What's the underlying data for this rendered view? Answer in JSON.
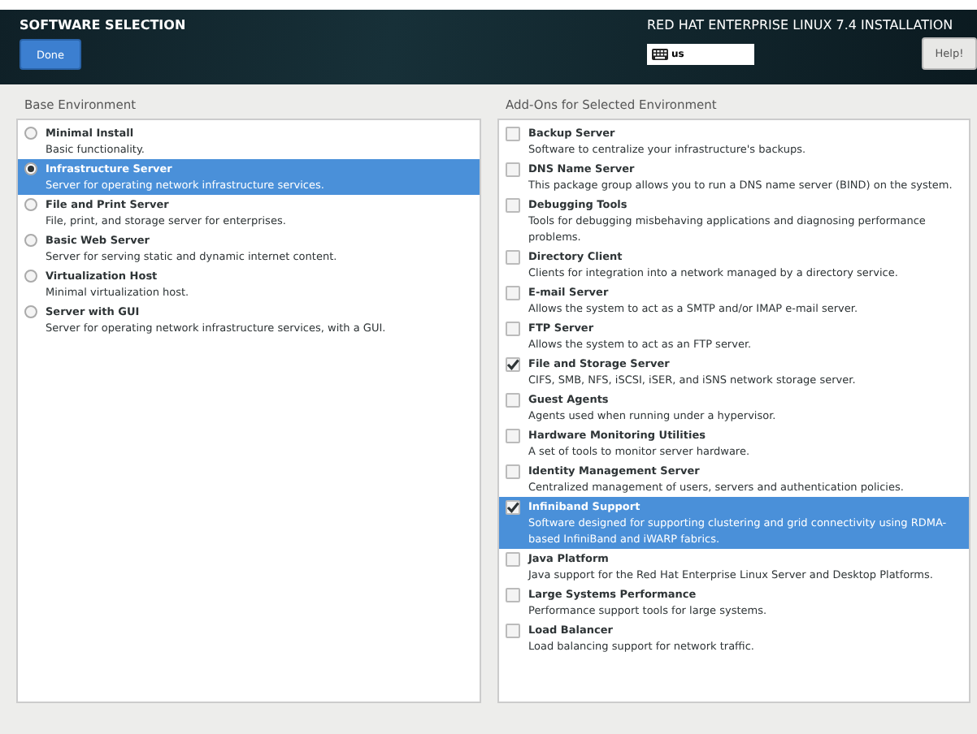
{
  "header": {
    "title": "SOFTWARE SELECTION",
    "done_button": "Done",
    "product": "RED HAT ENTERPRISE LINUX 7.4 INSTALLATION",
    "keyboard_layout": "us",
    "help_button": "Help!"
  },
  "base_environment": {
    "heading": "Base Environment",
    "items": [
      {
        "name": "Minimal Install",
        "description": "Basic functionality.",
        "selected": false
      },
      {
        "name": "Infrastructure Server",
        "description": "Server for operating network infrastructure services.",
        "selected": true
      },
      {
        "name": "File and Print Server",
        "description": "File, print, and storage server for enterprises.",
        "selected": false
      },
      {
        "name": "Basic Web Server",
        "description": "Server for serving static and dynamic internet content.",
        "selected": false
      },
      {
        "name": "Virtualization Host",
        "description": "Minimal virtualization host.",
        "selected": false
      },
      {
        "name": "Server with GUI",
        "description": "Server for operating network infrastructure services, with a GUI.",
        "selected": false
      }
    ]
  },
  "addons": {
    "heading": "Add-Ons for Selected Environment",
    "items": [
      {
        "name": "Backup Server",
        "description": "Software to centralize your infrastructure's backups.",
        "checked": false,
        "selected": false
      },
      {
        "name": "DNS Name Server",
        "description": "This package group allows you to run a DNS name server (BIND) on the system.",
        "checked": false,
        "selected": false
      },
      {
        "name": "Debugging Tools",
        "description": "Tools for debugging misbehaving applications and diagnosing performance problems.",
        "checked": false,
        "selected": false
      },
      {
        "name": "Directory Client",
        "description": "Clients for integration into a network managed by a directory service.",
        "checked": false,
        "selected": false
      },
      {
        "name": "E-mail Server",
        "description": "Allows the system to act as a SMTP and/or IMAP e-mail server.",
        "checked": false,
        "selected": false
      },
      {
        "name": "FTP Server",
        "description": "Allows the system to act as an FTP server.",
        "checked": false,
        "selected": false
      },
      {
        "name": "File and Storage Server",
        "description": "CIFS, SMB, NFS, iSCSI, iSER, and iSNS network storage server.",
        "checked": true,
        "selected": false
      },
      {
        "name": "Guest Agents",
        "description": "Agents used when running under a hypervisor.",
        "checked": false,
        "selected": false
      },
      {
        "name": "Hardware Monitoring Utilities",
        "description": "A set of tools to monitor server hardware.",
        "checked": false,
        "selected": false
      },
      {
        "name": "Identity Management Server",
        "description": "Centralized management of users, servers and authentication policies.",
        "checked": false,
        "selected": false
      },
      {
        "name": "Infiniband Support",
        "description": "Software designed for supporting clustering and grid connectivity using RDMA-based InfiniBand and iWARP fabrics.",
        "checked": true,
        "selected": true
      },
      {
        "name": "Java Platform",
        "description": "Java support for the Red Hat Enterprise Linux Server and Desktop Platforms.",
        "checked": false,
        "selected": false
      },
      {
        "name": "Large Systems Performance",
        "description": "Performance support tools for large systems.",
        "checked": false,
        "selected": false
      },
      {
        "name": "Load Balancer",
        "description": "Load balancing support for network traffic.",
        "checked": false,
        "selected": false
      }
    ]
  }
}
